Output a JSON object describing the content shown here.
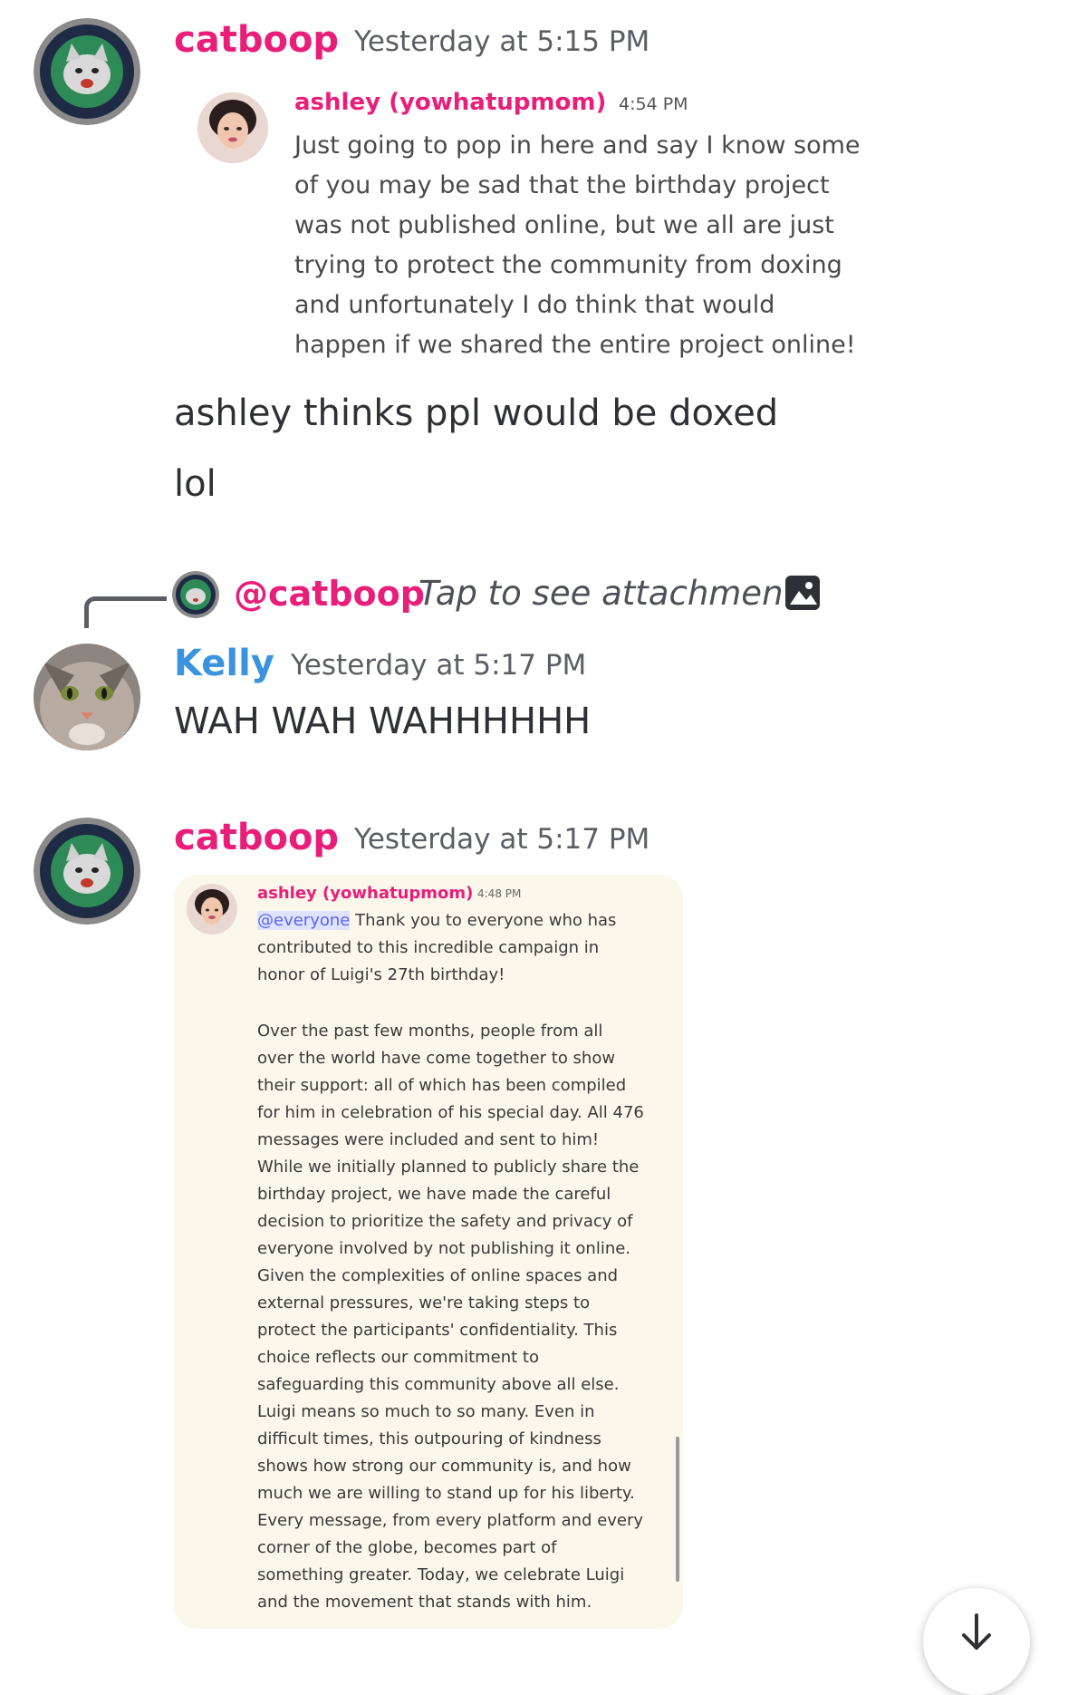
{
  "colors": {
    "catboop_name": "#e91e7a",
    "kelly_name": "#3b93e0",
    "mention": "#e91e7a",
    "timestamp": "#5c5e66"
  },
  "messages": [
    {
      "author": "catboop",
      "timestamp": "Yesterday at 5:15 PM",
      "quote": {
        "author": "ashley (yowhatupmom)",
        "time": "4:54 PM",
        "lines": [
          "Just going to pop in here and say I know some",
          "of you may be sad that the birthday project",
          "was not published online, but we all are just",
          "trying to protect the community from doxing",
          "and unfortunately I do think that would",
          "happen if we shared the entire project online!"
        ]
      },
      "lines": [
        "ashley thinks ppl would be doxed",
        "lol"
      ]
    },
    {
      "author": "Kelly",
      "timestamp": "Yesterday at 5:17 PM",
      "reply": {
        "mention": "@catboop",
        "text": "Tap to see attachment",
        "icon": "image-icon"
      },
      "text": "WAH WAH WAHHHHHH"
    },
    {
      "author": "catboop",
      "timestamp": "Yesterday at 5:17 PM",
      "quote": {
        "author": "ashley (yowhatupmom)",
        "time": "4:48 PM",
        "mention": "@everyone",
        "first_line_rest": " Thank you to everyone who has",
        "lines": [
          "contributed to this incredible campaign in",
          "honor of Luigi's 27th birthday!",
          "",
          "Over the past few months, people from all",
          "over the world have come together to show",
          "their support: all of which has been compiled",
          "for him in celebration of his special day. All 476",
          "messages were included and sent to him!",
          "While we initially planned to publicly share the",
          "birthday project, we have made the careful",
          "decision to prioritize the safety and privacy of",
          "everyone involved by not publishing it online.",
          "Given the complexities of online spaces and",
          "external pressures, we're taking steps to",
          "protect the participants' confidentiality. This",
          "choice reflects our commitment to",
          "safeguarding this community above all else.",
          "Luigi means so much to so many. Even in",
          "difficult times, this outpouring of kindness",
          "shows how strong our community is, and how",
          "much we are willing to stand up for his liberty.",
          "Every message, from every platform and every",
          "corner of the globe, becomes part of",
          "something greater. Today, we celebrate Luigi",
          "and the movement that stands with him."
        ]
      }
    }
  ],
  "scroll_button": {
    "icon": "arrow-down-icon"
  }
}
